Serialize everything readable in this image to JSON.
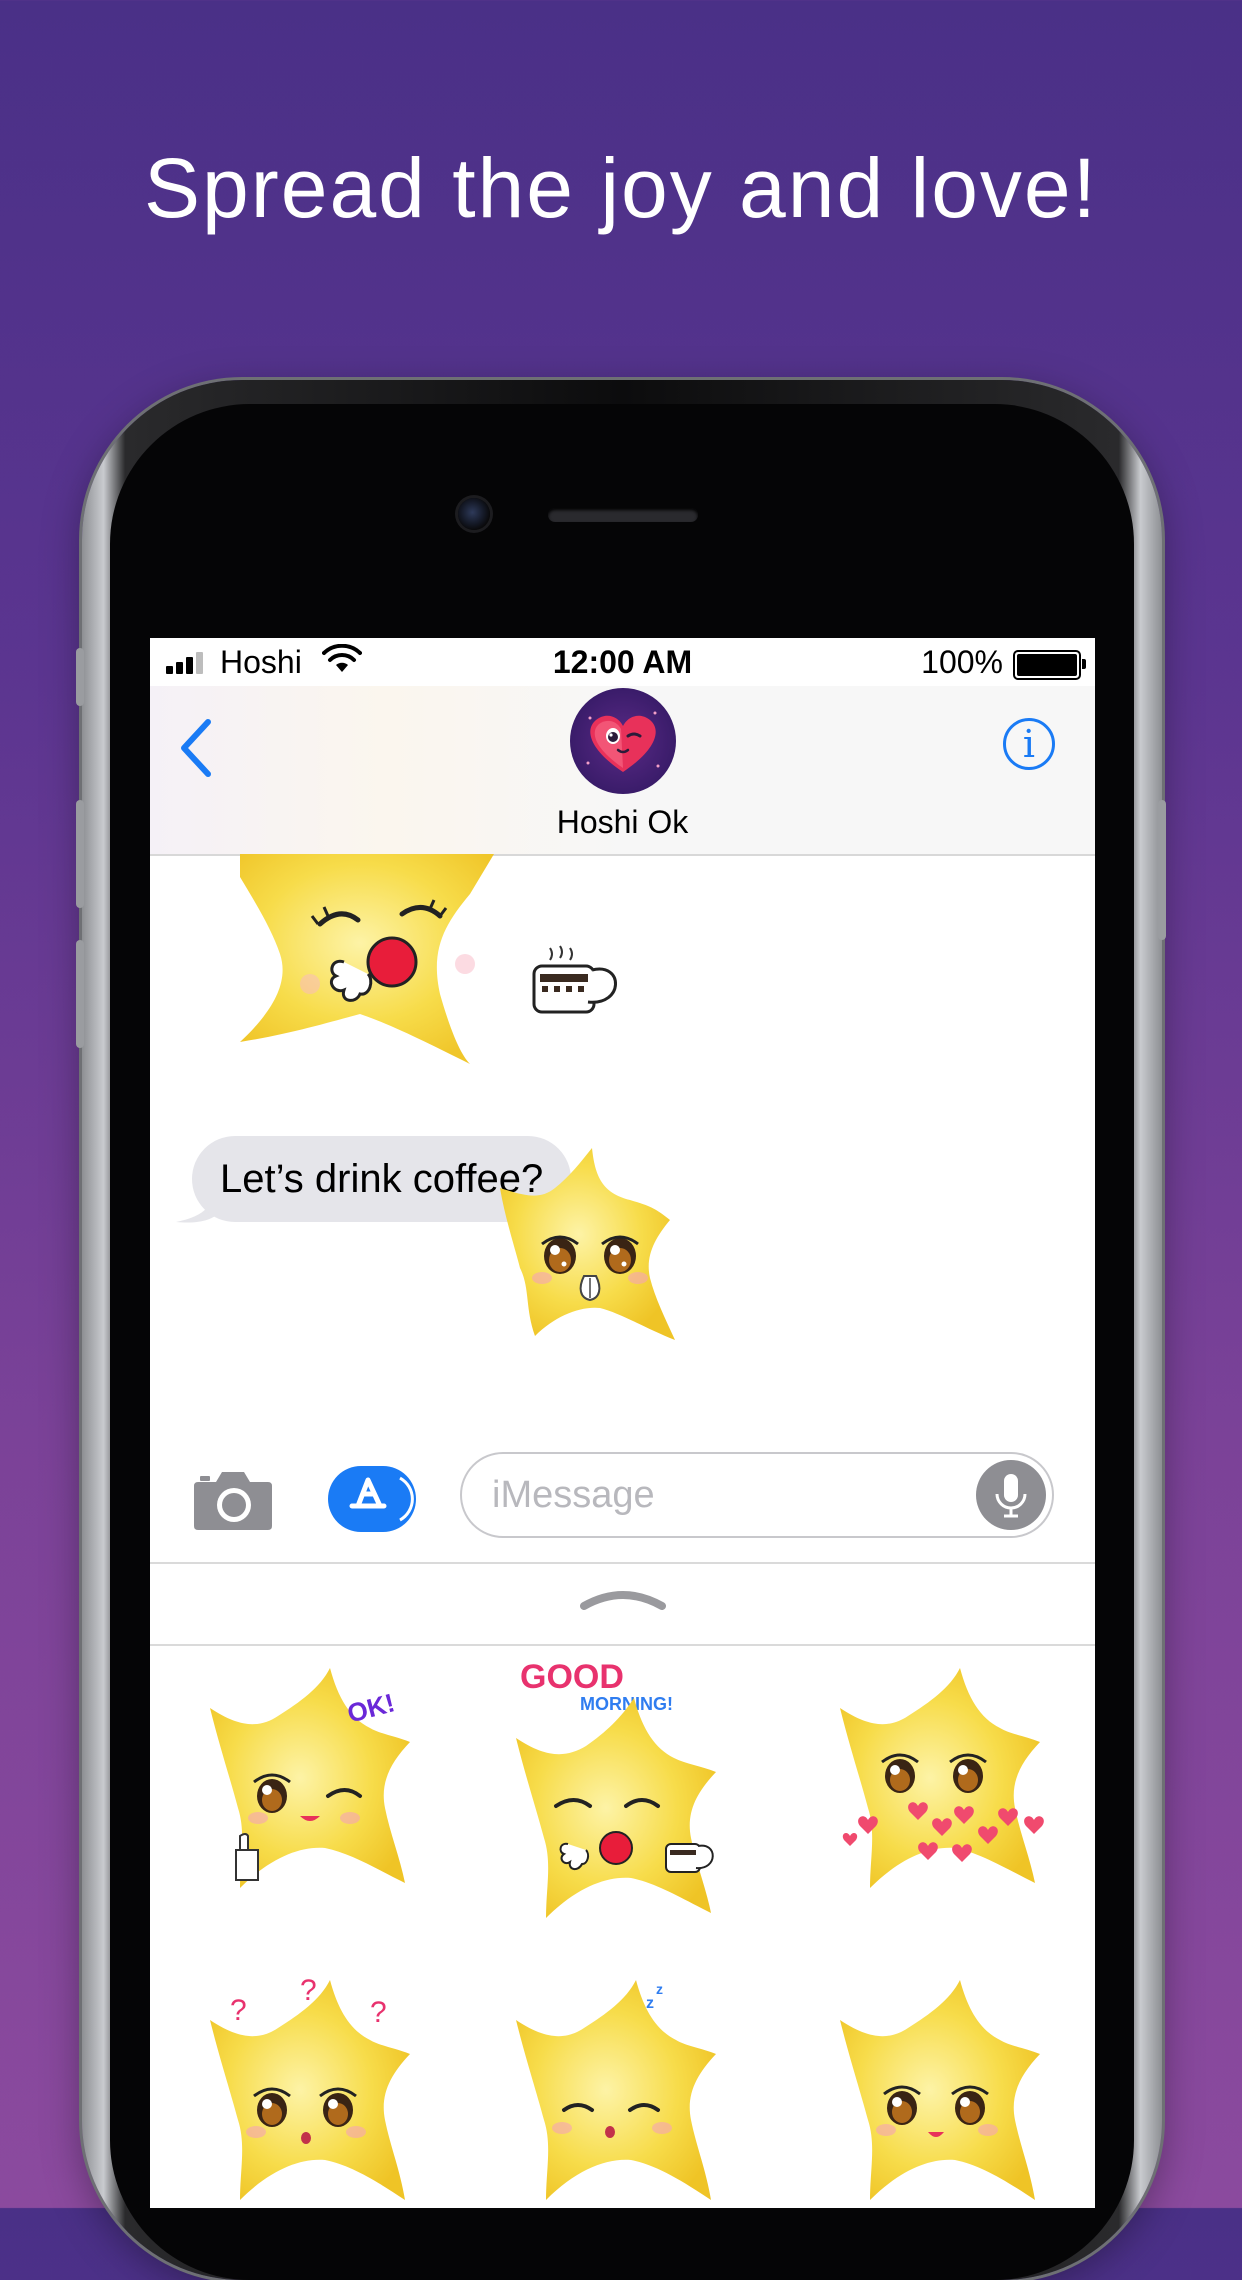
{
  "headline": "Spread the joy and love!",
  "status_bar": {
    "carrier": "Hoshi",
    "time": "12:00 AM",
    "battery": "100%"
  },
  "nav": {
    "contact_name": "Hoshi Ok",
    "info_glyph": "i"
  },
  "messages": [
    {
      "type": "sticker",
      "name": "star-coffee-sticker"
    },
    {
      "type": "text",
      "text": "Let’s drink coffee?"
    },
    {
      "type": "sticker",
      "name": "star-pleading-sticker"
    }
  ],
  "input": {
    "placeholder": "iMessage"
  },
  "sticker_tray": {
    "stickers": [
      {
        "name": "star-ok-wink",
        "caption": "OK!"
      },
      {
        "name": "star-good-morning",
        "caption_line1": "GOOD",
        "caption_line2": "MORNING!"
      },
      {
        "name": "star-hearts"
      },
      {
        "name": "star-confused",
        "marks": "? ? ?"
      },
      {
        "name": "star-sleepy",
        "marks": "z z"
      },
      {
        "name": "star-surprised"
      }
    ]
  },
  "colors": {
    "ios_blue": "#1a7bf5",
    "star_yellow": "#f7dc4a",
    "bubble_gray": "#e5e5ea"
  }
}
